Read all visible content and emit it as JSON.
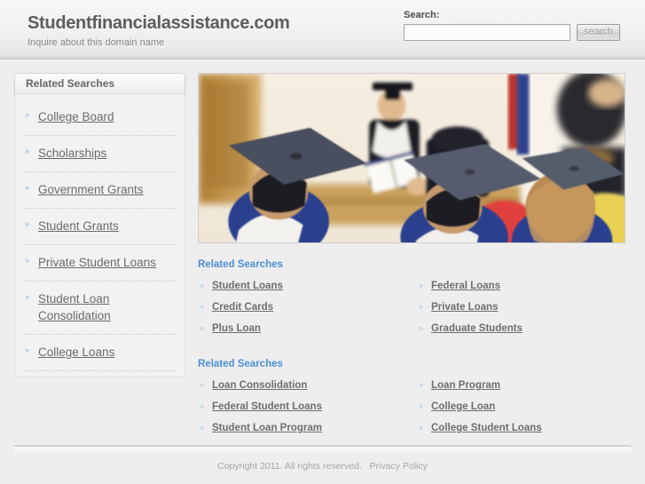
{
  "header": {
    "brand_title": "Studentfinancialassistance.com",
    "brand_subtitle": "Inquire about this domain name",
    "search_label": "Search:",
    "search_value": "",
    "search_placeholder": "",
    "search_button_label": "search"
  },
  "sidebar": {
    "heading": "Related Searches",
    "bullet": "»",
    "items": [
      {
        "label": "College Board"
      },
      {
        "label": "Scholarships"
      },
      {
        "label": "Government Grants"
      },
      {
        "label": "Student Grants"
      },
      {
        "label": "Private Student Loans"
      },
      {
        "label": "Student Loan Consolidation"
      },
      {
        "label": "College Loans"
      }
    ]
  },
  "main": {
    "hero_alt": "graduation-ceremony-photo",
    "bullet": "»",
    "blocks": [
      {
        "title": "Related Searches",
        "left": [
          {
            "label": "Student Loans"
          },
          {
            "label": "Credit Cards"
          },
          {
            "label": "Plus Loan"
          }
        ],
        "right": [
          {
            "label": "Federal Loans"
          },
          {
            "label": "Private Loans"
          },
          {
            "label": "Graduate Students"
          }
        ]
      },
      {
        "title": "Related Searches",
        "left": [
          {
            "label": "Loan Consolidation"
          },
          {
            "label": "Federal Student Loans"
          },
          {
            "label": "Student Loan Program"
          }
        ],
        "right": [
          {
            "label": "Loan Program"
          },
          {
            "label": "College Loan"
          },
          {
            "label": "College Student Loans"
          }
        ]
      }
    ]
  },
  "footer": {
    "copyright": "Copyright 2011. All rights reserved.",
    "privacy_link": "Privacy Policy"
  },
  "colors": {
    "page_background": "#eeeeee",
    "accent_blue": "#4c8fd6",
    "bullet_blue": "#9fc4e8",
    "link_gray": "#6e6e6e",
    "title_gray": "#5d5d5d",
    "footer_gray": "#a5a5a5"
  }
}
